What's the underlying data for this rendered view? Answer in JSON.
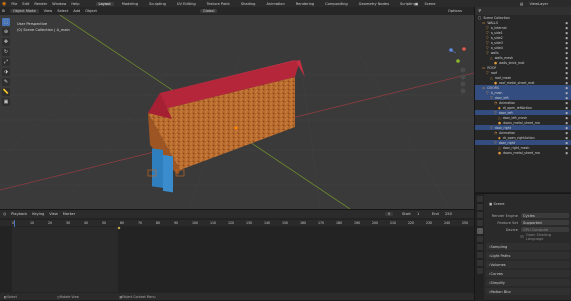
{
  "topbar": {
    "menus": [
      "File",
      "Edit",
      "Render",
      "Window",
      "Help"
    ],
    "workspaces": [
      "Layout",
      "Modeling",
      "Sculpting",
      "UV Editing",
      "Texture Paint",
      "Shading",
      "Animation",
      "Rendering",
      "Compositing",
      "Geometry Nodes",
      "Scripting"
    ],
    "active_workspace": "Layout",
    "scene": "Scene",
    "view_layer": "ViewLayer"
  },
  "viewport_header": {
    "mode": "Object Mode",
    "menus": [
      "View",
      "Select",
      "Add",
      "Object"
    ],
    "orientation": "Global",
    "options": "Options"
  },
  "viewport_info": {
    "line1": "User Perspective",
    "line2": "(0) Scene Collection | A_main"
  },
  "outliner": {
    "title": "Scene Collection",
    "rows": [
      {
        "label": "WALLS",
        "indent": 1,
        "icon": "collection-icon",
        "sel": false
      },
      {
        "label": "a_internal",
        "indent": 2,
        "icon": "object-icon",
        "sel": false
      },
      {
        "label": "a_side1",
        "indent": 2,
        "icon": "object-icon",
        "sel": false
      },
      {
        "label": "a_side2",
        "indent": 2,
        "icon": "object-icon",
        "sel": false
      },
      {
        "label": "a_side3",
        "indent": 2,
        "icon": "object-icon",
        "sel": false
      },
      {
        "label": "a_side4",
        "indent": 2,
        "icon": "object-icon",
        "sel": false
      },
      {
        "label": "walls",
        "indent": 2,
        "icon": "object-icon",
        "sel": false
      },
      {
        "label": "walls_mesh",
        "indent": 3,
        "icon": "mesh-icon",
        "sel": false
      },
      {
        "label": "walls_brick_mat",
        "indent": 4,
        "icon": "material-icon",
        "sel": false
      },
      {
        "label": "ROOF",
        "indent": 1,
        "icon": "collection-icon",
        "sel": false
      },
      {
        "label": "roof",
        "indent": 2,
        "icon": "object-icon",
        "sel": false
      },
      {
        "label": "roof_mesh",
        "indent": 3,
        "icon": "mesh-icon",
        "sel": false
      },
      {
        "label": "roof_metal_sheet_mat",
        "indent": 4,
        "icon": "material-icon",
        "sel": false
      },
      {
        "label": "DOORS",
        "indent": 1,
        "icon": "collection-icon",
        "sel": true
      },
      {
        "label": "A_main",
        "indent": 2,
        "icon": "object-icon",
        "sel": true
      },
      {
        "label": "door_left",
        "indent": 3,
        "icon": "object-icon",
        "sel": true
      },
      {
        "label": "Animation",
        "indent": 4,
        "icon": "anim-icon",
        "sel": false
      },
      {
        "label": "dl_open_leftAction",
        "indent": 5,
        "icon": "action-icon",
        "sel": false
      },
      {
        "label": "door_left",
        "indent": 4,
        "icon": "object-icon",
        "sel": true
      },
      {
        "label": "door_left_mesh",
        "indent": 5,
        "icon": "mesh-icon",
        "sel": false
      },
      {
        "label": "doors_metal_sheet_ma",
        "indent": 5,
        "icon": "material-icon",
        "sel": false
      },
      {
        "label": "door_right",
        "indent": 3,
        "icon": "object-icon",
        "sel": true
      },
      {
        "label": "Animation",
        "indent": 4,
        "icon": "anim-icon",
        "sel": false
      },
      {
        "label": "dr_open_rightAction",
        "indent": 5,
        "icon": "action-icon",
        "sel": false
      },
      {
        "label": "door_right",
        "indent": 4,
        "icon": "object-icon",
        "sel": true
      },
      {
        "label": "door_right_mesh",
        "indent": 5,
        "icon": "mesh-icon",
        "sel": false
      },
      {
        "label": "doors_metal_sheet_ma",
        "indent": 5,
        "icon": "material-icon",
        "sel": false
      }
    ]
  },
  "properties": {
    "title": "Scene",
    "render_engine_label": "Render Engine",
    "render_engine": "Cycles",
    "feature_set_label": "Feature Set",
    "feature_set": "Supported",
    "device_label": "Device",
    "device": "GPU Compute",
    "osl_label": "Open Shading Language",
    "panels": [
      "Sampling",
      "Light Paths",
      "Volumes",
      "Curves",
      "Simplify",
      "Motion Blur"
    ]
  },
  "timeline": {
    "menus": [
      "Playback",
      "Keying",
      "View",
      "Marker"
    ],
    "frame_numbers": [
      "0",
      "10",
      "20",
      "30",
      "40",
      "50",
      "60",
      "70",
      "80",
      "90",
      "100",
      "110",
      "120",
      "130",
      "140",
      "150",
      "160",
      "170",
      "180",
      "190",
      "200",
      "210",
      "220",
      "230",
      "240",
      "250"
    ],
    "current_frame": "0",
    "start_label": "Start",
    "start": "1",
    "end_label": "End",
    "end": "250"
  },
  "status": {
    "select": "Select",
    "rotate": "Rotate View",
    "context": "Object Context Menu"
  }
}
